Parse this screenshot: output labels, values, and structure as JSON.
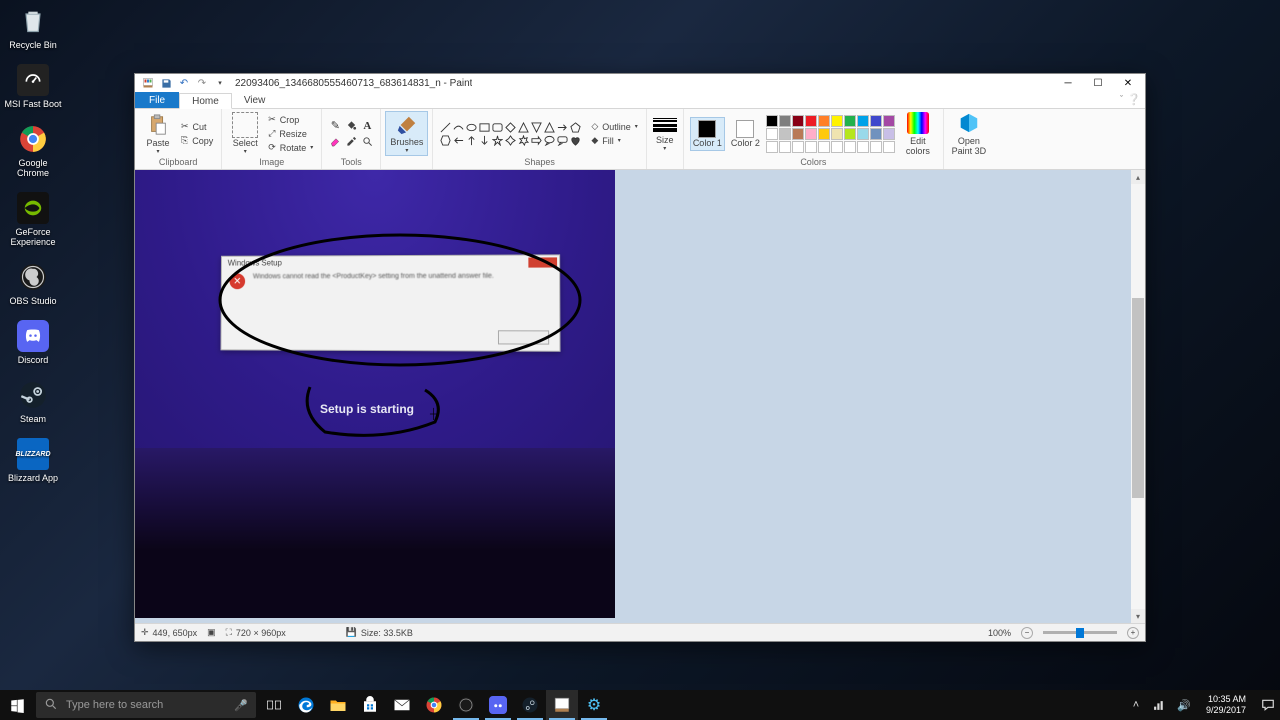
{
  "desktop": {
    "icons": [
      {
        "name": "recycle-bin",
        "label": "Recycle Bin"
      },
      {
        "name": "msi-fast-boot",
        "label": "MSI Fast Boot"
      },
      {
        "name": "google-chrome",
        "label": "Google Chrome"
      },
      {
        "name": "geforce-experience",
        "label": "GeForce Experience"
      },
      {
        "name": "obs-studio",
        "label": "OBS Studio"
      },
      {
        "name": "discord",
        "label": "Discord"
      },
      {
        "name": "steam",
        "label": "Steam"
      },
      {
        "name": "blizzard-app",
        "label": "Blizzard App"
      }
    ]
  },
  "paint": {
    "title": "22093406_1346680555460713_683614831_n - Paint",
    "tabs": {
      "file": "File",
      "home": "Home",
      "view": "View"
    },
    "ribbon": {
      "clipboard": {
        "label": "Clipboard",
        "paste": "Paste",
        "cut": "Cut",
        "copy": "Copy"
      },
      "image": {
        "label": "Image",
        "select": "Select",
        "crop": "Crop",
        "resize": "Resize",
        "rotate": "Rotate"
      },
      "tools": {
        "label": "Tools"
      },
      "brushes": {
        "label": "Brushes"
      },
      "shapes": {
        "label": "Shapes",
        "outline": "Outline",
        "fill": "Fill"
      },
      "size": {
        "label": "Size"
      },
      "colors": {
        "label": "Colors",
        "color1": "Color 1",
        "color2": "Color 2",
        "edit": "Edit colors",
        "c1_hex": "#000000",
        "c2_hex": "#ffffff",
        "palette_row1": [
          "#000000",
          "#7f7f7f",
          "#880015",
          "#ed1c24",
          "#ff7f27",
          "#fff200",
          "#22b14c",
          "#00a2e8",
          "#3f48cc",
          "#a349a4"
        ],
        "palette_row2": [
          "#ffffff",
          "#c3c3c3",
          "#b97a57",
          "#ffaec9",
          "#ffc90e",
          "#efe4b0",
          "#b5e61d",
          "#99d9ea",
          "#7092be",
          "#c8bfe7"
        ],
        "palette_row3": [
          "#ffffff",
          "#ffffff",
          "#ffffff",
          "#ffffff",
          "#ffffff",
          "#ffffff",
          "#ffffff",
          "#ffffff",
          "#ffffff",
          "#ffffff"
        ]
      },
      "paint3d": "Open Paint 3D"
    },
    "canvas": {
      "dialog_title": "Windows Setup",
      "dialog_msg": "Windows cannot read the <ProductKey> setting from the unattend answer file.",
      "setup_text": "Setup is starting"
    },
    "statusbar": {
      "cursor_pos": "449, 650px",
      "image_dim": "720 × 960px",
      "file_size": "Size: 33.5KB",
      "zoom": "100%"
    }
  },
  "taskbar": {
    "search_placeholder": "Type here to search",
    "clock_time": "10:35 AM",
    "clock_date": "9/29/2017"
  }
}
